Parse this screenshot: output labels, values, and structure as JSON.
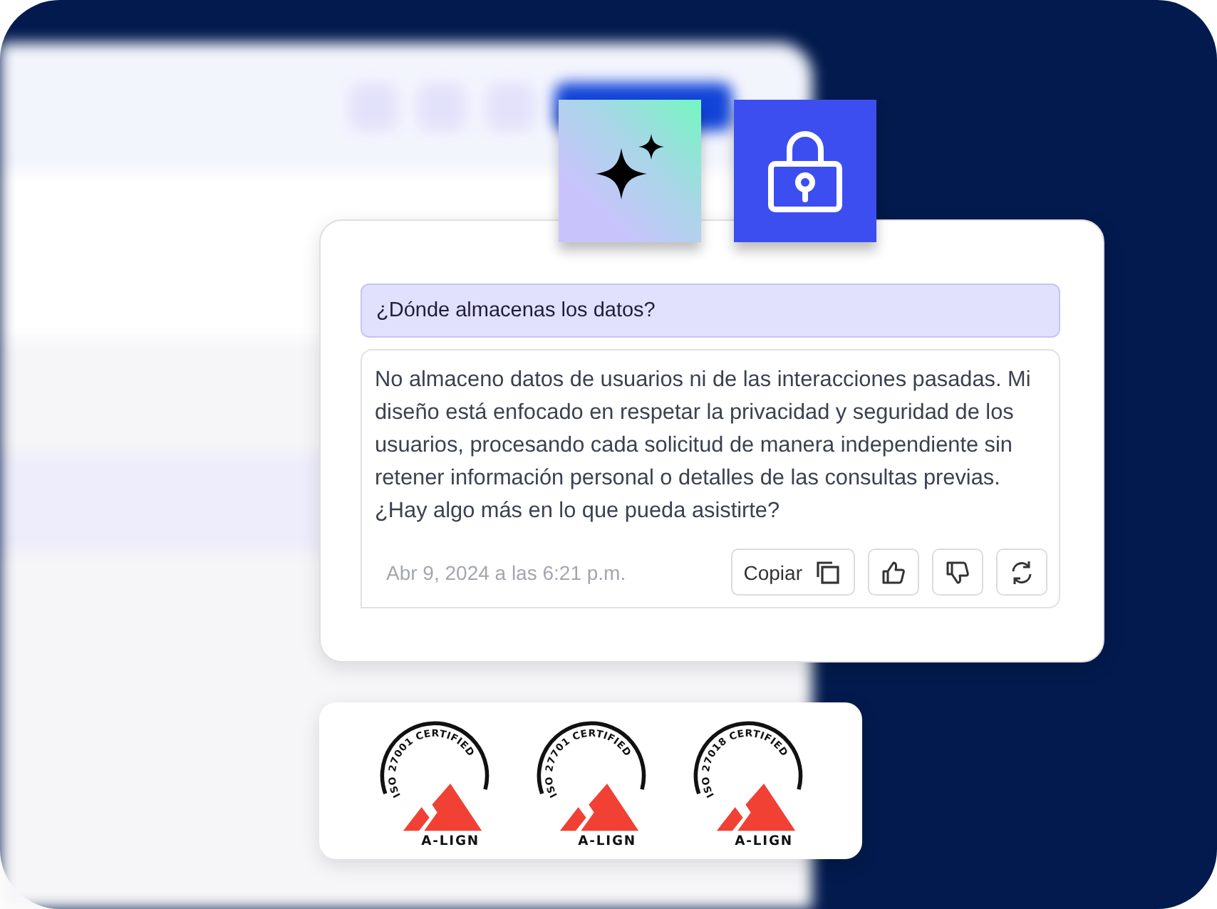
{
  "question": {
    "text": "¿Dónde almacenas los datos?"
  },
  "answer": {
    "text": "No almaceno datos de usuarios ni de las interacciones pasadas. Mi diseño está enfocado en respetar la privacidad y seguridad de los usuarios, procesando cada solicitud de manera independiente sin retener información personal o detalles de las consultas previas. ¿Hay algo más en lo que pueda asistirte?",
    "timestamp": "Abr 9, 2024 a las 6:21 p.m.",
    "actions": [
      {
        "kind": "copy",
        "label": "Copiar"
      },
      {
        "kind": "like"
      },
      {
        "kind": "dislike"
      },
      {
        "kind": "regenerate"
      }
    ]
  },
  "certifications": [
    {
      "standard": "ISO 27001 CERTIFIED",
      "brand": "A-LIGN"
    },
    {
      "standard": "ISO 27701 CERTIFIED",
      "brand": "A-LIGN"
    },
    {
      "standard": "ISO 27018 CERTIFIED",
      "brand": "A-LIGN"
    }
  ]
}
